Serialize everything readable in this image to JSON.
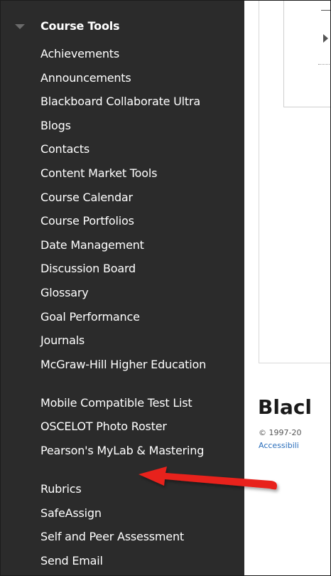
{
  "sidebar": {
    "section_title": "Course Tools",
    "items": [
      {
        "label": "Achievements"
      },
      {
        "label": "Announcements"
      },
      {
        "label": "Blackboard Collaborate Ultra"
      },
      {
        "label": "Blogs"
      },
      {
        "label": "Contacts"
      },
      {
        "label": "Content Market Tools"
      },
      {
        "label": "Course Calendar"
      },
      {
        "label": "Course Portfolios"
      },
      {
        "label": "Date Management"
      },
      {
        "label": "Discussion Board"
      },
      {
        "label": "Glossary"
      },
      {
        "label": "Goal Performance"
      },
      {
        "label": "Journals"
      },
      {
        "label": "McGraw-Hill Higher Education"
      },
      {
        "label": "Mobile Compatible Test List"
      },
      {
        "label": "OSCELOT Photo Roster"
      },
      {
        "label": "Pearson's MyLab & Mastering"
      },
      {
        "label": "Rubrics"
      },
      {
        "label": "SafeAssign"
      },
      {
        "label": "Self and Peer Assessment"
      },
      {
        "label": "Send Email"
      }
    ]
  },
  "main": {
    "brand_text": "Blacl",
    "copyright": "© 1997-20",
    "accessibility": "Accessibili"
  },
  "annotation": {
    "arrow_color": "#e8201c",
    "arrow_points_to": "Pearson's MyLab & Mastering"
  },
  "colors": {
    "sidebar_bg": "#2b2b2b",
    "sidebar_text": "#ffffff",
    "link": "#2a6ebb"
  }
}
